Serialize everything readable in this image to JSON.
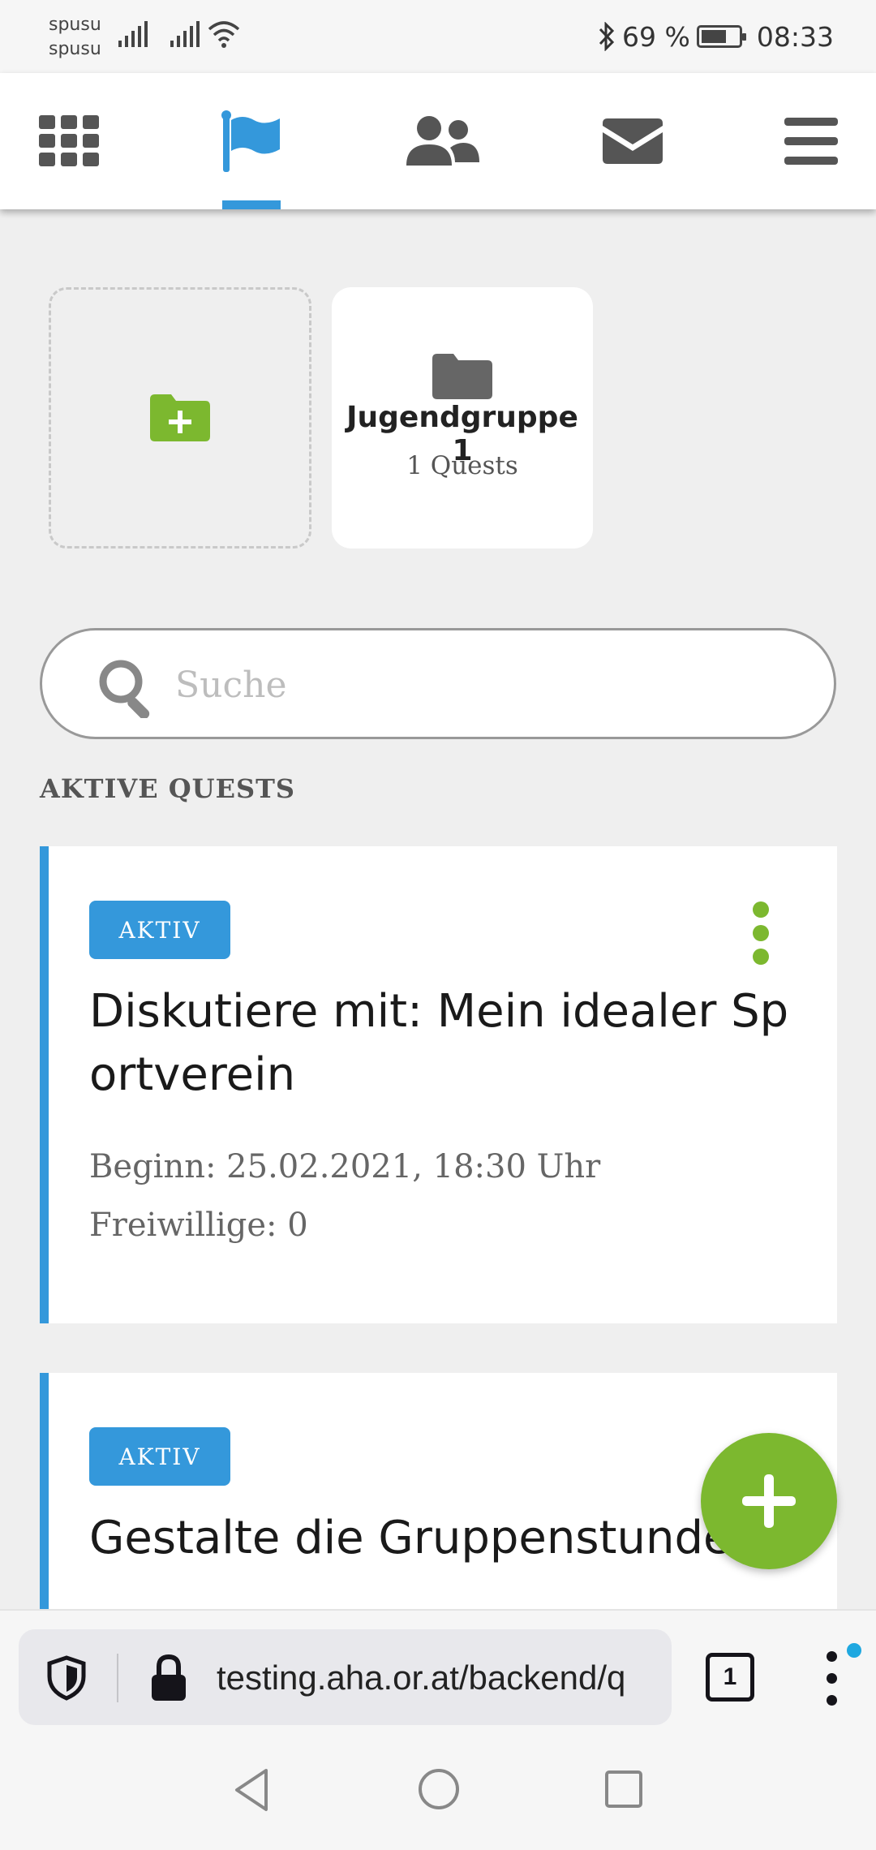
{
  "status_bar": {
    "carrier_1": "spusu",
    "carrier_2": "spusu",
    "battery_text": "69 %",
    "battery_level": 0.69,
    "time": "08:33",
    "icons": [
      "signal-icon",
      "signal-icon",
      "wifi-icon",
      "bluetooth-icon",
      "battery-icon"
    ]
  },
  "top_nav": {
    "items": [
      "dashboard-grid-icon",
      "quests-flag-icon",
      "groups-users-icon",
      "messages-envelope-icon",
      "menu-hamburger-icon"
    ],
    "active": "quests-flag-icon",
    "accent_color": "#3498db"
  },
  "groups": {
    "add_tile_icon": "folder-plus-icon",
    "items": [
      {
        "title": "Jugendgruppe 1",
        "subtitle": "1 Quests",
        "icon": "folder-icon"
      }
    ]
  },
  "search": {
    "placeholder": "Suche",
    "value": ""
  },
  "section": {
    "title": "AKTIVE QUESTS"
  },
  "quests": [
    {
      "badge": "AKTIV",
      "title": "Diskutiere mit: Mein idealer Sportverein",
      "start": "Beginn: 25.02.2021, 18:30 Uhr",
      "volunteers": "Freiwillige: 0"
    },
    {
      "badge": "AKTIV",
      "title": "Gestalte die Gruppenstunden"
    }
  ],
  "fab": {
    "icon": "plus-icon",
    "color": "#7cb82f"
  },
  "browser": {
    "url": "testing.aha.or.at/backend/q",
    "tab_count": "1"
  },
  "system_nav": [
    "back-icon",
    "home-icon",
    "recents-icon"
  ]
}
